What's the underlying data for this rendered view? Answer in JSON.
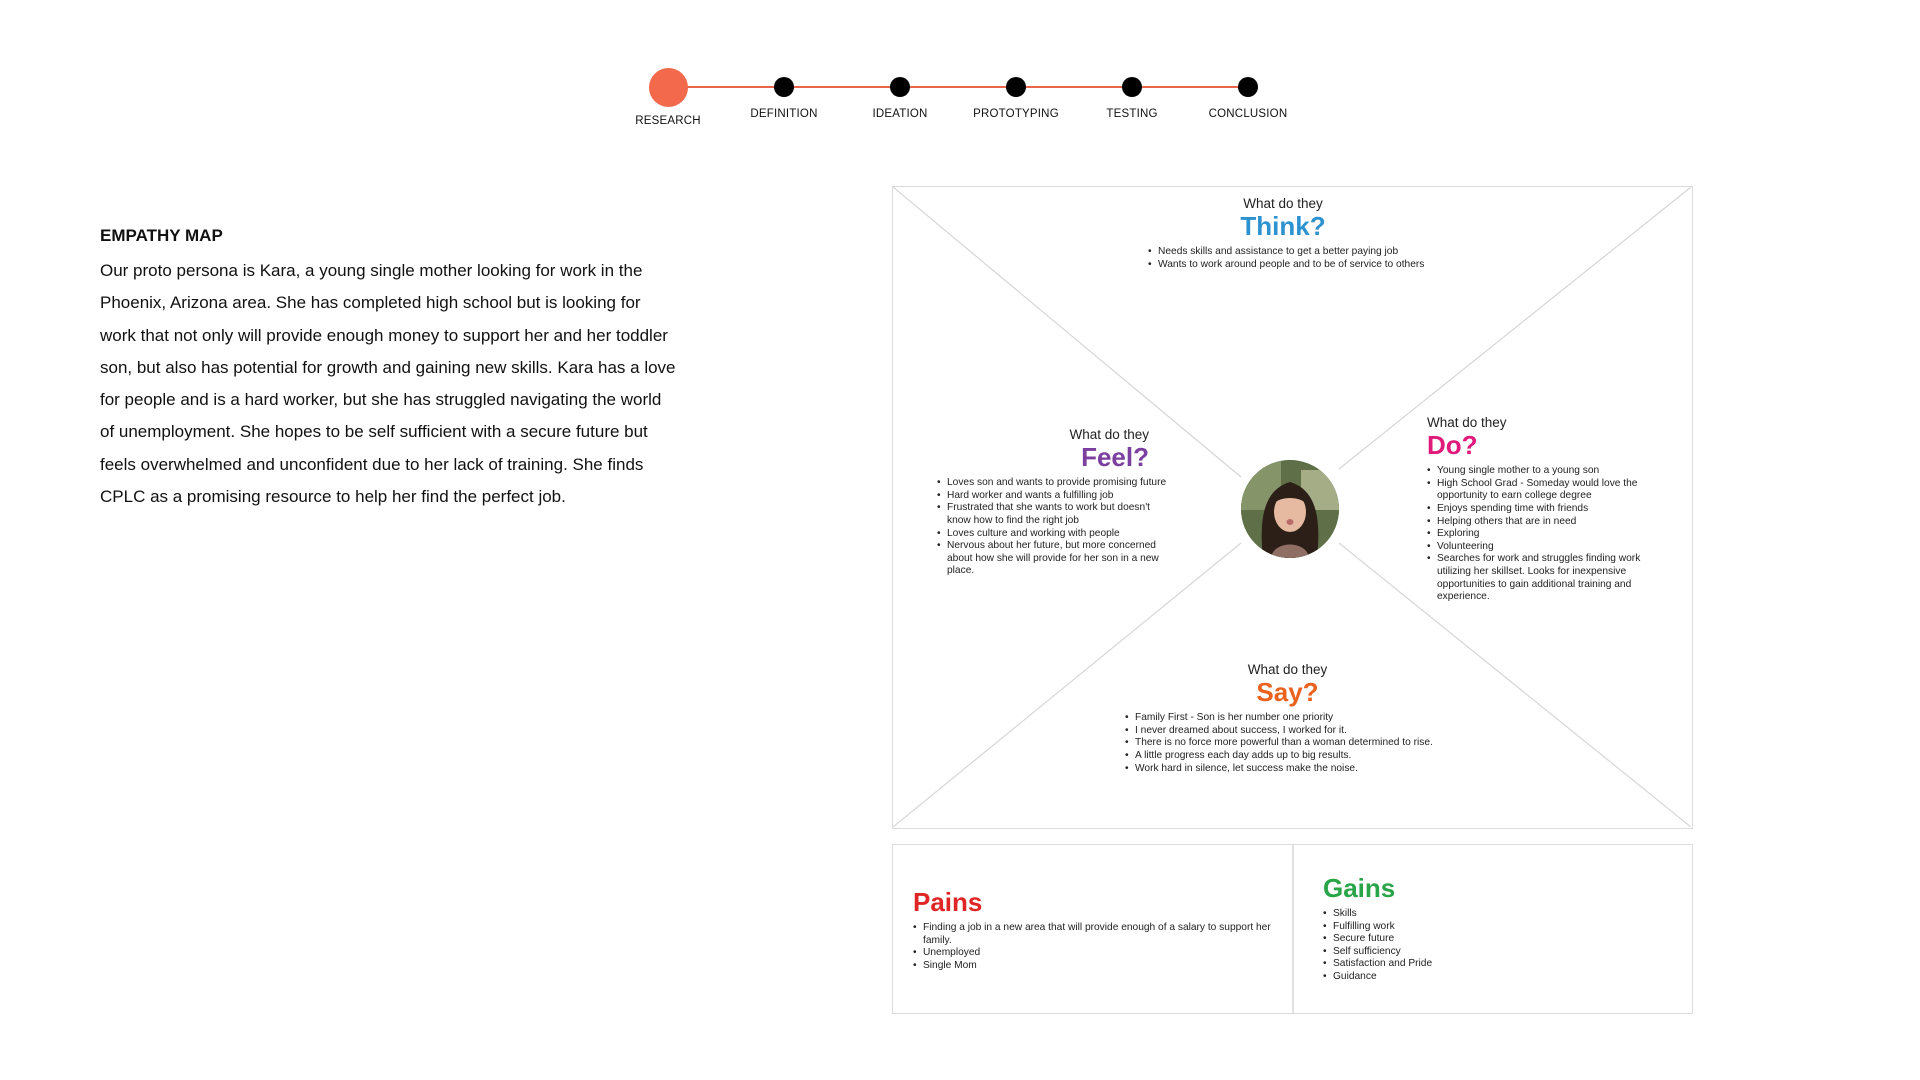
{
  "stepper": {
    "steps": [
      {
        "label": "RESEARCH",
        "active": true
      },
      {
        "label": "DEFINITION",
        "active": false
      },
      {
        "label": "IDEATION",
        "active": false
      },
      {
        "label": "PROTOTYPING",
        "active": false
      },
      {
        "label": "TESTING",
        "active": false
      },
      {
        "label": "CONCLUSION",
        "active": false
      }
    ],
    "colors": {
      "active": "#f2694c",
      "line": "#e8664c",
      "dot": "#000000"
    }
  },
  "intro": {
    "heading": "EMPATHY MAP",
    "body": "Our proto persona is Kara, a young single mother looking for work in the Phoenix, Arizona area. She has completed high school but is looking for work that not only will provide enough money to support her and her toddler son, but also has potential for growth and gaining new skills. Kara has a love for people and is a hard worker, but she has struggled navigating the world of unemployment. She hopes to be self sufficient with a secure future but feels overwhelmed and unconfident due to her lack of training. She finds CPLC as a promising resource to help her find the perfect job."
  },
  "empathy_map": {
    "think": {
      "kicker": "What do they",
      "title": "Think?",
      "color": "#2d93d0",
      "items": [
        "Needs skills and assistance to get a better paying job",
        "Wants to work around people and to be of service to others"
      ]
    },
    "feel": {
      "kicker": "What do they",
      "title": "Feel?",
      "color": "#7b3fa0",
      "items": [
        "Loves son and wants to provide promising future",
        "Hard worker and wants a fulfilling job",
        "Frustrated that she wants to work but doesn't know how to find the right job",
        "Loves culture and working with people",
        "Nervous about her future, but more concerned about how she will provide for her son in a new place."
      ]
    },
    "do": {
      "kicker": "What do they",
      "title": "Do?",
      "color": "#e0197b",
      "items": [
        "Young single mother to a young son",
        "High School Grad - Someday would love the opportunity to earn college degree",
        "Enjoys spending time with friends",
        "Helping others that are in need",
        "Exploring",
        "Volunteering",
        "Searches for work and struggles finding work utilizing her skillset. Looks for inexpensive opportunities to gain additional training and experience."
      ]
    },
    "say": {
      "kicker": "What do they",
      "title": "Say?",
      "color": "#ea621e",
      "items": [
        "Family First - Son is her number one priority",
        "I never dreamed about success, I worked for it.",
        "There is no force more powerful than a woman determined to rise.",
        "A little progress each day adds up to big results.",
        "Work hard in silence, let success make the noise."
      ]
    }
  },
  "pains_gains": {
    "pains": {
      "title": "Pains",
      "color": "#e02525",
      "items": [
        "Finding a job in a new area that will provide enough of a salary to support her family.",
        "Unemployed",
        "Single Mom"
      ]
    },
    "gains": {
      "title": "Gains",
      "color": "#2aa448",
      "items": [
        "Skills",
        "Fulfilling work",
        "Secure future",
        "Self sufficiency",
        "Satisfaction and Pride",
        "Guidance"
      ]
    }
  }
}
